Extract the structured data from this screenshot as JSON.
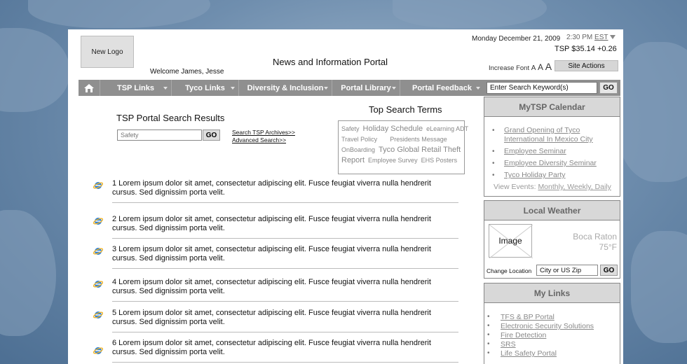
{
  "header": {
    "logo_label": "New Logo",
    "welcome": "Welcome James, Jesse",
    "portal_title": "News and Information Portal",
    "date": "Monday December 21, 2009",
    "time": "2:30 PM",
    "timezone": "EST",
    "stock": "TSP $35.14 +0.26",
    "increase_font_label": "Increase Font",
    "font_a": "A",
    "site_actions": "Site Actions"
  },
  "nav": {
    "items": [
      "TSP Links",
      "Tyco Links",
      "Diversity & Inclusion",
      "Portal Library",
      "Portal Feedback"
    ],
    "search_value": "Enter Search Keyword(s)",
    "go_label": "GO"
  },
  "results": {
    "title": "TSP Portal Search Results",
    "search_placeholder": "Safety",
    "go_label": "GO",
    "archive_link": "Search TSP Archives>>",
    "advanced_link": "Advanced Search>>",
    "items": [
      "1 Lorem ipsum dolor sit amet, consectetur adipiscing elit. Fusce feugiat viverra nulla hendrerit cursus. Sed dignissim porta velit.",
      "2 Lorem ipsum dolor sit amet, consectetur adipiscing elit. Fusce feugiat viverra nulla hendrerit cursus. Sed dignissim porta velit.",
      "3 Lorem ipsum dolor sit amet, consectetur adipiscing elit. Fusce feugiat viverra nulla hendrerit cursus. Sed dignissim porta velit.",
      "4 Lorem ipsum dolor sit amet, consectetur adipiscing elit. Fusce feugiat viverra nulla hendrerit cursus. Sed dignissim porta velit.",
      "5 Lorem ipsum dolor sit amet, consectetur adipiscing elit. Fusce feugiat viverra nulla hendrerit cursus. Sed dignissim porta velit.",
      "6 Lorem ipsum dolor sit amet, consectetur adipiscing elit. Fusce feugiat viverra nulla hendrerit cursus. Sed dignissim porta velit."
    ]
  },
  "top_terms": {
    "title": "Top Search Terms",
    "terms": [
      "Safety",
      "Holiday Schedule",
      "eLearning ADT",
      "Travel Policy",
      "Presidents Message",
      "OnBoarding",
      "Tyco Global Retail Theft",
      "Report",
      "Employee Survey",
      "EHS Posters"
    ]
  },
  "calendar": {
    "title": "MyTSP Calendar",
    "events": [
      "Grand Opening of Tyco International In Mexico City",
      "Employee Seminar",
      "Employee Diversity Seminar",
      "Tyco Holiday Party"
    ],
    "view_events_label": "View Events:",
    "view_events_links": "Monthly, Weekly, Daily"
  },
  "weather": {
    "title": "Local Weather",
    "image_label": "Image",
    "city": "Boca Raton",
    "temp": "75°F",
    "change_location": "Change Location",
    "zip_value": "City or US Zip",
    "go_label": "GO"
  },
  "my_links": {
    "title": "My Links",
    "items": [
      "TFS & BP Portal",
      "Electronic Security Solutions",
      "Fire Detection",
      "SRS",
      "Life Safety Portal"
    ]
  }
}
